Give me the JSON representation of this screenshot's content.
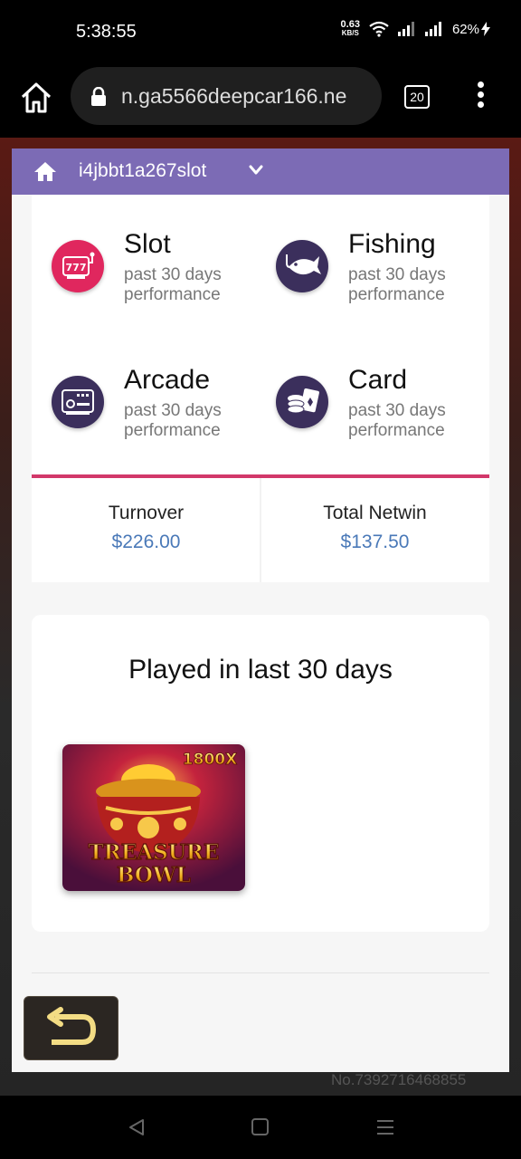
{
  "status_bar": {
    "time": "5:38:55",
    "net_speed_value": "0.63",
    "net_speed_unit": "KB/S",
    "battery": "62%"
  },
  "browser": {
    "url": "n.ga5566deepcar166.ne",
    "tab_count": "20"
  },
  "header": {
    "username": "i4jbbt1a267slot"
  },
  "categories": [
    {
      "title": "Slot",
      "sub": "past 30 days performance",
      "icon": "slot-machine-icon",
      "color": "#e0275e"
    },
    {
      "title": "Fishing",
      "sub": "past 30 days performance",
      "icon": "fish-icon",
      "color": "#3b2f5c"
    },
    {
      "title": "Arcade",
      "sub": "past 30 days performance",
      "icon": "arcade-icon",
      "color": "#3b2f5c"
    },
    {
      "title": "Card",
      "sub": "past 30 days performance",
      "icon": "cards-icon",
      "color": "#3b2f5c"
    }
  ],
  "stats": {
    "turnover_label": "Turnover",
    "turnover_value": "$226.00",
    "netwin_label": "Total Netwin",
    "netwin_value": "$137.50"
  },
  "played": {
    "title": "Played in last 30 days",
    "games": [
      {
        "name_line1": "TREASURE",
        "name_line2": "BOWL",
        "multiplier": "1800X"
      }
    ]
  },
  "footer": {
    "serial": "No.7392716468855"
  },
  "colors": {
    "accent_purple": "#7c6bb5",
    "accent_pink": "#d2386a",
    "value_blue": "#4a79b8"
  }
}
